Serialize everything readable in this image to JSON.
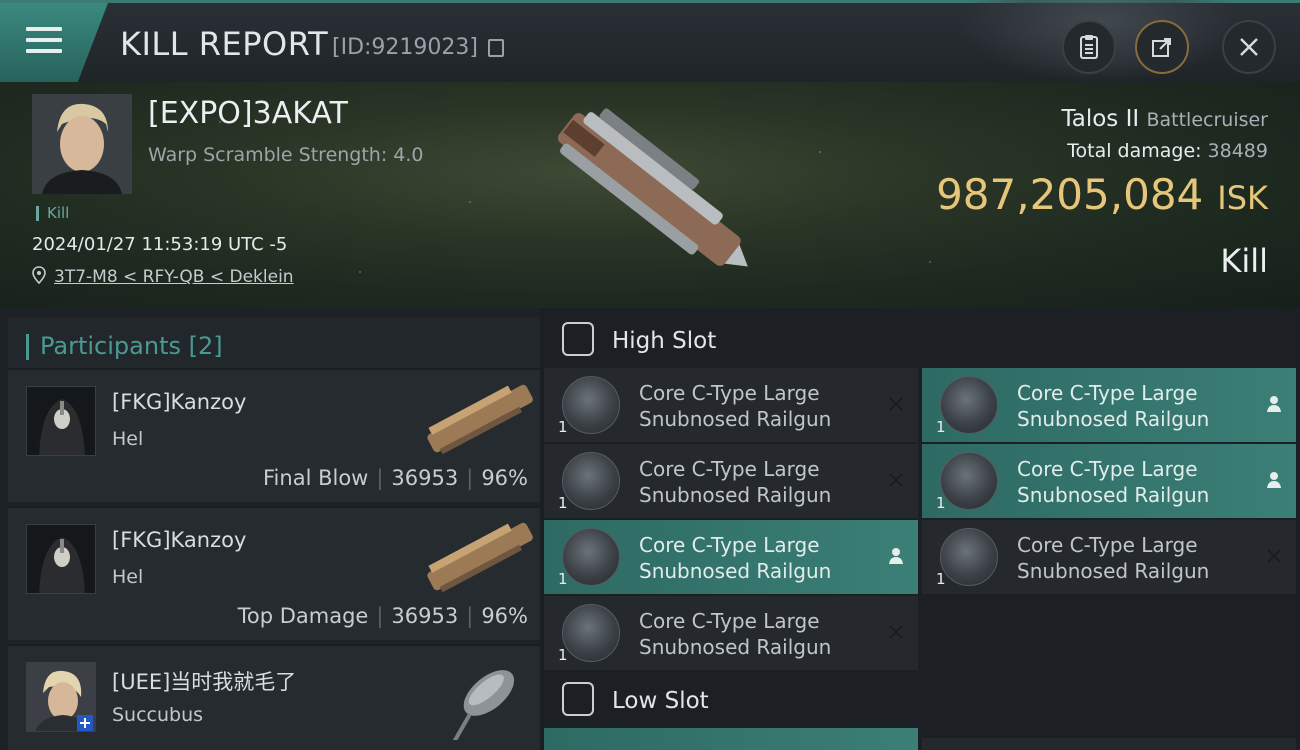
{
  "header": {
    "title": "KILL REPORT",
    "id_text": "[ID:9219023]"
  },
  "victim": {
    "name": "[EXPO]3AKAT",
    "subtitle": "Warp Scramble Strength: 4.0",
    "tag": "Kill",
    "datetime": "2024/01/27 11:53:19 UTC -5",
    "location": "3T7-M8 < RFY-QB < Deklein",
    "ship_name": "Talos II",
    "ship_class": "Battlecruiser",
    "total_damage_label": "Total damage:",
    "total_damage": "38489",
    "isk_value": "987,205,084",
    "isk_unit": "ISK",
    "result": "Kill"
  },
  "participants": {
    "title": "Participants [2]",
    "items": [
      {
        "name": "[FKG]Kanzoy",
        "ship": "Hel",
        "role": "Final Blow",
        "damage": "36953",
        "percent": "96%"
      },
      {
        "name": "[FKG]Kanzoy",
        "ship": "Hel",
        "role": "Top Damage",
        "damage": "36953",
        "percent": "96%"
      },
      {
        "name": "[UEE]当时我就毛了",
        "ship": "Succubus"
      }
    ]
  },
  "high_slot": {
    "label": "High Slot",
    "modules": [
      {
        "line1": "Core C-Type Large",
        "line2": "Snubnosed Railgun",
        "qty": "1",
        "status": "destroyed",
        "status_icon": "x-icon"
      },
      {
        "line1": "Core C-Type Large",
        "line2": "Snubnosed Railgun",
        "qty": "1",
        "status": "dropped",
        "status_icon": "person-icon"
      },
      {
        "line1": "Core C-Type Large",
        "line2": "Snubnosed Railgun",
        "qty": "1",
        "status": "destroyed",
        "status_icon": "x-icon"
      },
      {
        "line1": "Core C-Type Large",
        "line2": "Snubnosed Railgun",
        "qty": "1",
        "status": "dropped",
        "status_icon": "person-icon"
      },
      {
        "line1": "Core C-Type Large",
        "line2": "Snubnosed Railgun",
        "qty": "1",
        "status": "dropped",
        "status_icon": "person-icon"
      },
      {
        "line1": "Core C-Type Large",
        "line2": "Snubnosed Railgun",
        "qty": "1",
        "status": "destroyed",
        "status_icon": "x-icon"
      },
      {
        "line1": "Core C-Type Large",
        "line2": "Snubnosed Railgun",
        "qty": "1",
        "status": "destroyed",
        "status_icon": "x-icon"
      }
    ]
  },
  "low_slot": {
    "label": "Low Slot"
  },
  "colors": {
    "accent": "#4a9a92",
    "isk": "#e6c77a",
    "dropped_bg": "#3b7f77"
  }
}
